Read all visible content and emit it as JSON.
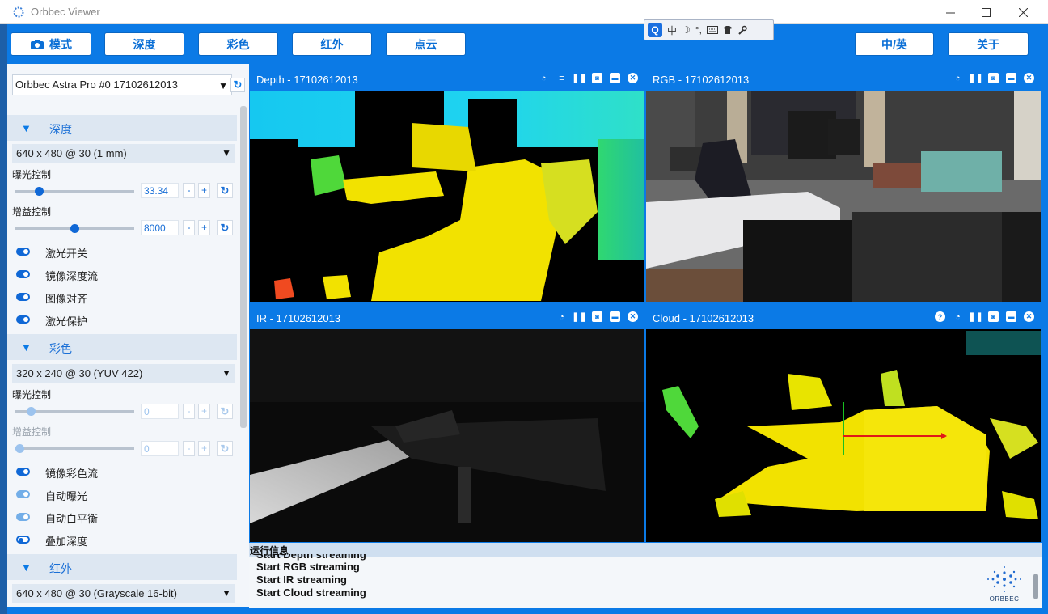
{
  "window": {
    "title": "Orbbec Viewer"
  },
  "toolbar": {
    "mode_label": "模式",
    "depth_label": "深度",
    "color_label": "彩色",
    "ir_label": "红外",
    "cloud_label": "点云",
    "lang_label": "中/英",
    "about_label": "关于"
  },
  "ime": {
    "q": "Q",
    "lang": "中",
    "moon": "☽",
    "punct": "°,"
  },
  "device": {
    "name": "Orbbec Astra Pro #0 17102612013"
  },
  "depth_section": {
    "title": "深度",
    "mode": "640 x 480 @ 30 (1 mm)",
    "exposure_label": "曝光控制",
    "exposure_value": "33.34",
    "exposure_level": 0.18,
    "gain_label": "增益控制",
    "gain_value": "8000",
    "gain_level": 0.5,
    "toggles": [
      {
        "label": "激光开关",
        "state": "on"
      },
      {
        "label": "镜像深度流",
        "state": "on"
      },
      {
        "label": "图像对齐",
        "state": "on"
      },
      {
        "label": "激光保护",
        "state": "on"
      }
    ]
  },
  "color_section": {
    "title": "彩色",
    "mode": "320 x 240 @ 30 (YUV 422)",
    "exposure_label": "曝光控制",
    "exposure_value": "0",
    "exposure_level": 0.1,
    "gain_label": "增益控制",
    "gain_value": "0",
    "gain_level": 0.0,
    "toggles": [
      {
        "label": "镜像彩色流",
        "state": "on"
      },
      {
        "label": "自动曝光",
        "state": "disabled"
      },
      {
        "label": "自动白平衡",
        "state": "disabled"
      },
      {
        "label": "叠加深度",
        "state": "off"
      }
    ]
  },
  "ir_section": {
    "title": "红外",
    "mode": "640 x 480 @ 30 (Grayscale 16-bit)"
  },
  "panes": {
    "depth_title": "Depth - 17102612013",
    "rgb_title": "RGB - 17102612013",
    "ir_title": "IR - 17102612013",
    "cloud_title": "Cloud - 17102612013"
  },
  "log": {
    "header": "运行信息",
    "lines": [
      "Start Depth streaming",
      "Start RGB streaming",
      "Start IR streaming",
      "Start Cloud streaming"
    ]
  },
  "logo": {
    "text": "ORBBEC"
  },
  "colors": {
    "accent": "#0b7ae6",
    "panel": "#f3f6fa",
    "depth_yellow": "#f2e200",
    "depth_cyan": "#1fd4f0"
  }
}
